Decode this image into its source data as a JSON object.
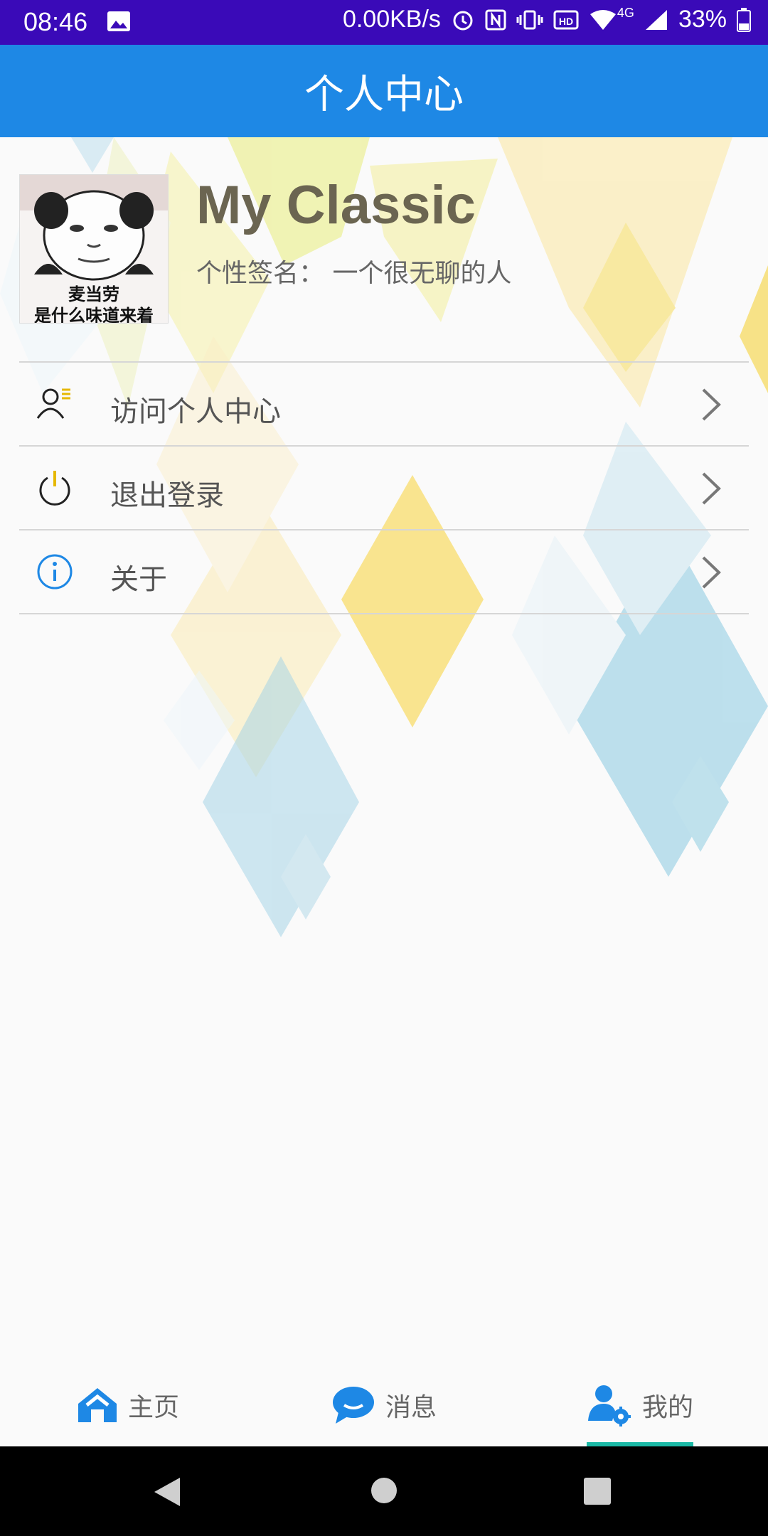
{
  "status_bar": {
    "time": "08:46",
    "net_speed": "0.00KB/s",
    "network": "4G",
    "battery": "33%",
    "icons": [
      "image-icon",
      "alarm-icon",
      "nfc-icon",
      "vibrate-icon",
      "hd-icon",
      "wifi-icon",
      "signal-icon",
      "battery-icon"
    ]
  },
  "app_bar": {
    "title": "个人中心"
  },
  "profile": {
    "name": "My Classic",
    "signature": "个性签名： 一个很无聊的人",
    "avatar_caption_line1": "麦当劳",
    "avatar_caption_line2": "是什么味道来着"
  },
  "menu": [
    {
      "label": "访问个人中心",
      "icon": "user-list-icon"
    },
    {
      "label": "退出登录",
      "icon": "power-icon"
    },
    {
      "label": "关于",
      "icon": "info-icon"
    }
  ],
  "bottom_nav": [
    {
      "label": "主页",
      "icon": "home-icon",
      "active": false
    },
    {
      "label": "消息",
      "icon": "chat-icon",
      "active": false
    },
    {
      "label": "我的",
      "icon": "user-settings-icon",
      "active": true
    }
  ],
  "colors": {
    "status_bar": "#3a0ab8",
    "app_bar": "#1e88e5",
    "accent_indicator": "#1bb9a6",
    "name_text": "#6b6551",
    "info_icon": "#1e88e5"
  }
}
